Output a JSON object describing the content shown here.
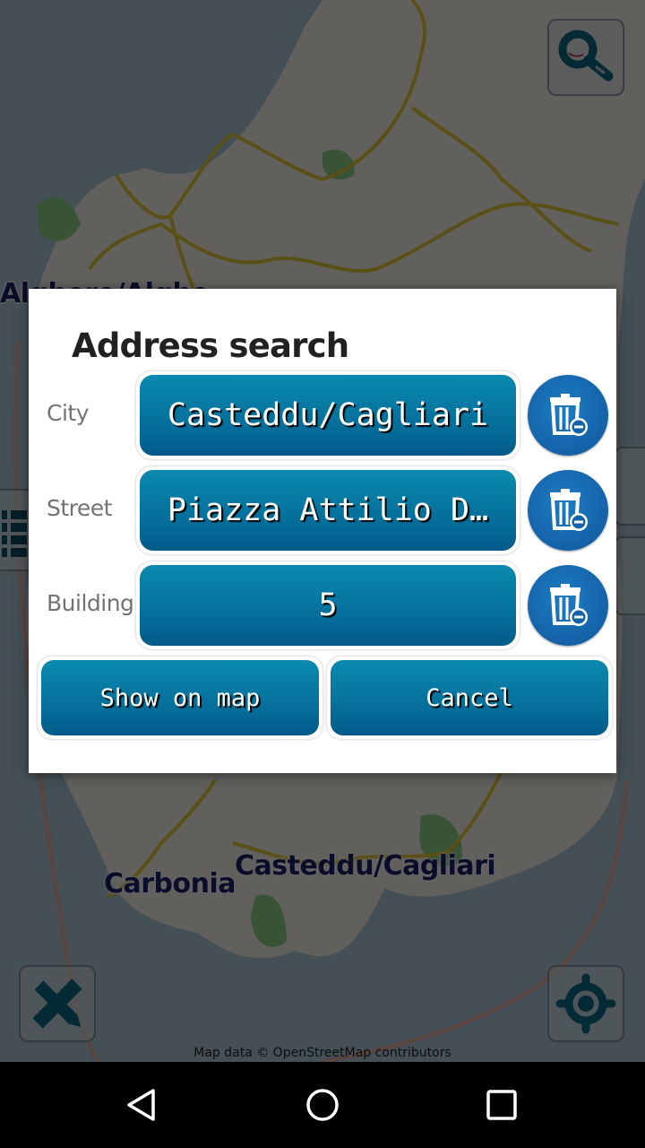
{
  "map": {
    "labels": {
      "alghero_partial": "Alghero/Alghe",
      "carbonia": "Carbonia",
      "cagliari": "Casteddu/Cagliari"
    },
    "attribution": "Map data © OpenStreetMap contributors",
    "buttons": {
      "search_icon": "search-icon",
      "measure_icon": "ruler-pencil-icon",
      "locate_icon": "crosshair-icon"
    }
  },
  "dialog": {
    "title": "Address search",
    "fields": [
      {
        "label": "City",
        "value": "Casteddu/Cagliari"
      },
      {
        "label": "Street",
        "value": "Piazza Attilio D…"
      },
      {
        "label": "Building",
        "value": "5"
      }
    ],
    "clear_icon": "trash-minus-icon",
    "buttons": {
      "show_on_map": "Show on map",
      "cancel": "Cancel"
    }
  },
  "colors": {
    "button_blue": "#056b98",
    "trash_blue": "#1462a8",
    "label_dark": "#1c1e66"
  },
  "navbar": {
    "back": "back-icon",
    "home": "home-icon",
    "recents": "recents-icon"
  }
}
